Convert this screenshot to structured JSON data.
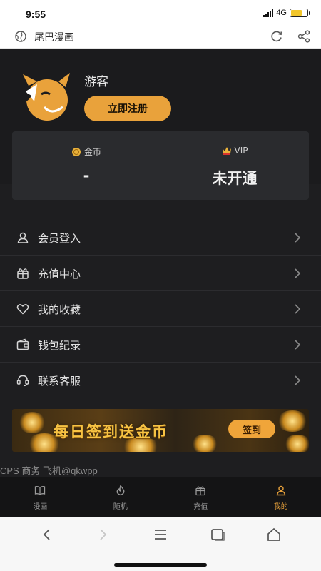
{
  "status_bar": {
    "time": "9:55",
    "network": "4G",
    "battery_percent": 70
  },
  "browser": {
    "title": "尾巴漫画"
  },
  "profile": {
    "username": "游客",
    "register_label": "立即注册"
  },
  "stats": {
    "coins": {
      "label": "金币",
      "value": "-"
    },
    "vip": {
      "label": "VIP",
      "value": "未开通"
    }
  },
  "menu": [
    {
      "label": "会员登入",
      "icon": "user-icon"
    },
    {
      "label": "充值中心",
      "icon": "gift-icon"
    },
    {
      "label": "我的收藏",
      "icon": "heart-icon"
    },
    {
      "label": "钱包纪录",
      "icon": "wallet-icon"
    },
    {
      "label": "联系客服",
      "icon": "headset-icon"
    }
  ],
  "banner": {
    "text": "每日签到送金币",
    "button": "签到"
  },
  "footer_note": "CPS 商务 飞机@qkwpp",
  "tabs": [
    {
      "label": "漫画",
      "icon": "book-icon",
      "active": false
    },
    {
      "label": "随机",
      "icon": "flame-icon",
      "active": false
    },
    {
      "label": "充值",
      "icon": "gift-icon",
      "active": false
    },
    {
      "label": "我的",
      "icon": "user-icon",
      "active": true
    }
  ],
  "colors": {
    "accent": "#e9a23b",
    "background": "#1e1e20",
    "card": "#2a2b2e",
    "tabbar": "#141415"
  }
}
